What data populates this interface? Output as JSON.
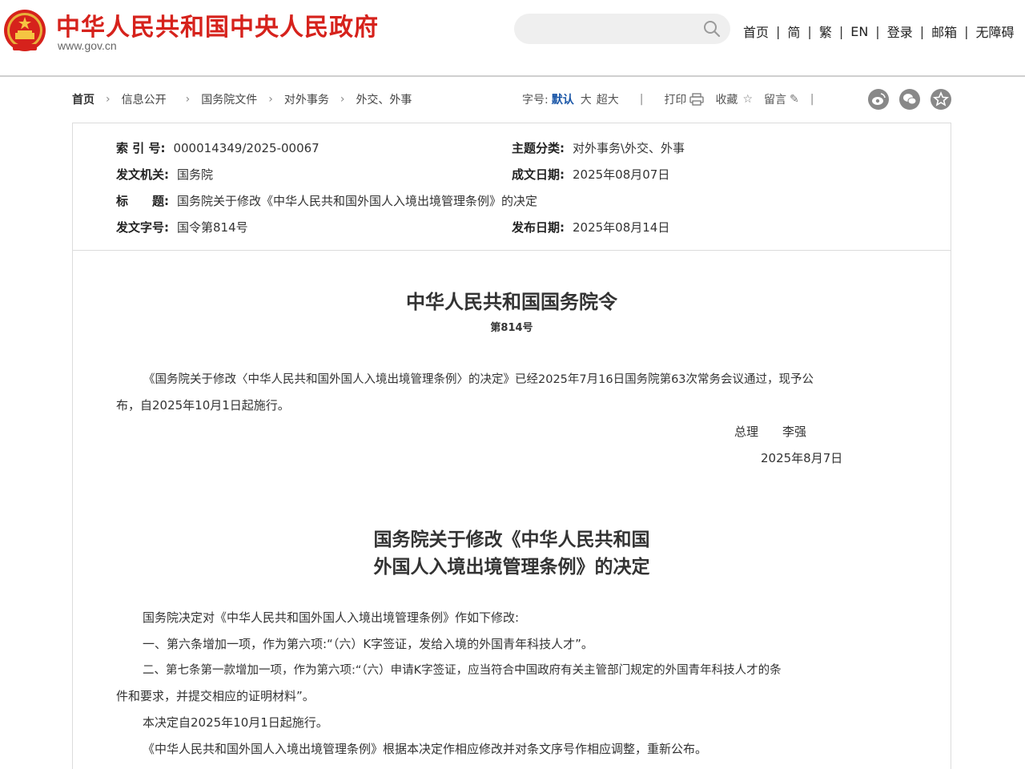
{
  "header": {
    "site_title": "中华人民共和国中央人民政府",
    "site_url": "www.gov.cn",
    "nav": [
      "首页",
      "简",
      "繁",
      "EN",
      "登录",
      "邮箱",
      "无障碍"
    ],
    "search_placeholder": ""
  },
  "breadcrumb": [
    "首页",
    "信息公开",
    "国务院文件",
    "对外事务",
    "外交、外事"
  ],
  "tools": {
    "font_label": "字号:",
    "font_default": "默认",
    "font_large": "大",
    "font_xlarge": "超大",
    "print": "打印",
    "favorite": "收藏",
    "comment": "留言"
  },
  "meta": {
    "index_label": "索 引 号:",
    "index_value": "000014349/2025-00067",
    "topic_label": "主题分类:",
    "topic_value": "对外事务\\外交、外事",
    "issuer_label": "发文机关:",
    "issuer_value": "国务院",
    "written_label": "成文日期:",
    "written_value": "2025年08月07日",
    "title_label": "标　　题:",
    "title_value": "国务院关于修改《中华人民共和国外国人入境出境管理条例》的决定",
    "docno_label": "发文字号:",
    "docno_value": "国令第814号",
    "published_label": "发布日期:",
    "published_value": "2025年08月14日"
  },
  "order": {
    "title": "中华人民共和国国务院令",
    "number": "第814号",
    "body_line1": "《国务院关于修改〈中华人民共和国外国人入境出境管理条例〉的决定》已经2025年7月16日国务院第63次常务会议通过，现予公",
    "body_line2": "布，自2025年10月1日起施行。",
    "signer": "总理　　李强",
    "date": "2025年8月7日"
  },
  "decision": {
    "title_line1": "国务院关于修改《中华人民共和国",
    "title_line2": "外国人入境出境管理条例》的决定",
    "p1": "国务院决定对《中华人民共和国外国人入境出境管理条例》作如下修改:",
    "p2": "一、第六条增加一项，作为第六项:“（六）K字签证，发给入境的外国青年科技人才”。",
    "p3_line1": "二、第七条第一款增加一项，作为第六项:“（六）申请K字签证，应当符合中国政府有关主管部门规定的外国青年科技人才的条",
    "p3_line2": "件和要求，并提交相应的证明材料”。",
    "p4": "本决定自2025年10月1日起施行。",
    "p5": "《中华人民共和国外国人入境出境管理条例》根据本决定作相应修改并对条文序号作相应调整，重新公布。"
  },
  "colors": {
    "brand_red": "#d6221c",
    "link_blue": "#1a56a7"
  }
}
